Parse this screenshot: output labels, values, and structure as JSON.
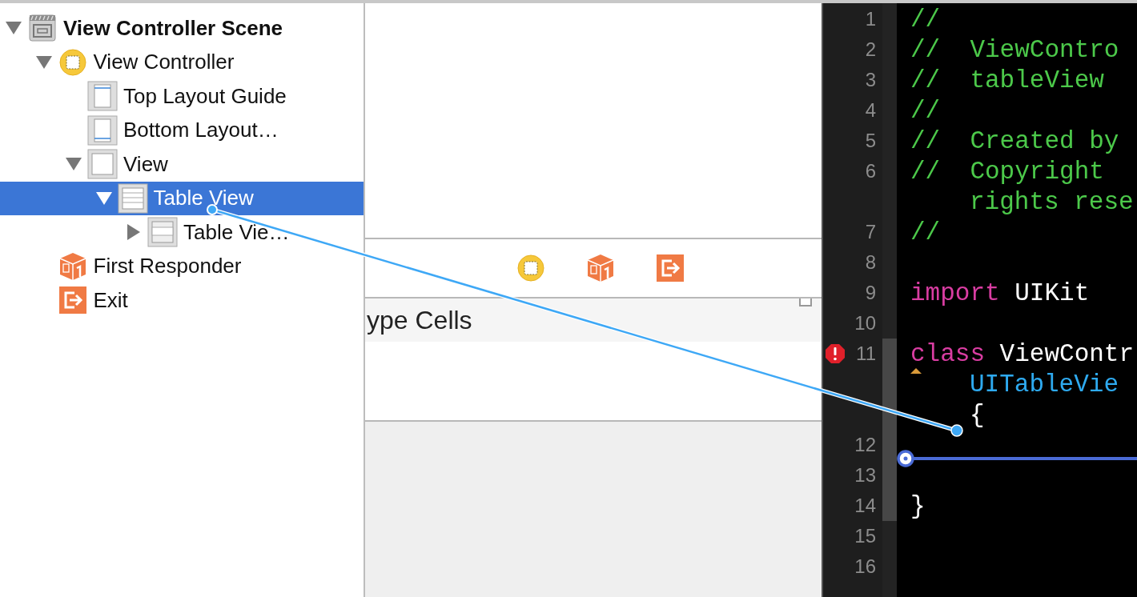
{
  "outline": {
    "items": [
      {
        "label": "View Controller Scene",
        "kind": "scene",
        "expanded": true,
        "selected": false,
        "children": [
          {
            "label": "View Controller",
            "kind": "controller",
            "expanded": true,
            "selected": false,
            "children": [
              {
                "label": "Top Layout Guide",
                "kind": "guide-top",
                "selected": false
              },
              {
                "label": "Bottom Layout…",
                "kind": "guide-bottom",
                "selected": false
              },
              {
                "label": "View",
                "kind": "view",
                "expanded": true,
                "selected": false,
                "children": [
                  {
                    "label": "Table View",
                    "kind": "table",
                    "expanded": true,
                    "selected": true,
                    "children": [
                      {
                        "label": "Table Vie…",
                        "kind": "table-cell",
                        "expanded": false,
                        "selected": false
                      }
                    ]
                  }
                ]
              }
            ]
          },
          {
            "label": "First Responder",
            "kind": "responder",
            "selected": false
          },
          {
            "label": "Exit",
            "kind": "exit",
            "selected": false
          }
        ]
      }
    ]
  },
  "canvas": {
    "dock_icons": [
      {
        "kind": "controller"
      },
      {
        "kind": "responder"
      },
      {
        "kind": "exit"
      }
    ],
    "section_header": "ype Cells"
  },
  "editor": {
    "rows": [
      {
        "number": "1",
        "segments": [
          {
            "kind": "comment",
            "text": "//"
          }
        ]
      },
      {
        "number": "2",
        "segments": [
          {
            "kind": "comment",
            "text": "//  ViewContro"
          }
        ]
      },
      {
        "number": "3",
        "segments": [
          {
            "kind": "comment",
            "text": "//  tableView"
          }
        ]
      },
      {
        "number": "4",
        "segments": [
          {
            "kind": "comment",
            "text": "//"
          }
        ]
      },
      {
        "number": "5",
        "segments": [
          {
            "kind": "comment",
            "text": "//  Created by"
          }
        ]
      },
      {
        "number": "6",
        "segments": [
          {
            "kind": "comment",
            "text": "//  Copyright"
          }
        ]
      },
      {
        "continuation": true,
        "segments": [
          {
            "kind": "comment",
            "text": "rights rese"
          }
        ]
      },
      {
        "number": "7",
        "segments": [
          {
            "kind": "comment",
            "text": "//"
          }
        ]
      },
      {
        "number": "8",
        "segments": []
      },
      {
        "number": "9",
        "segments": [
          {
            "kind": "keyword",
            "text": "import"
          },
          {
            "kind": "plain",
            "text": " UIKit"
          }
        ]
      },
      {
        "number": "10",
        "segments": []
      },
      {
        "number": "11",
        "changed": true,
        "error": true,
        "segments": [
          {
            "kind": "keyword",
            "text": "class"
          },
          {
            "kind": "plain",
            "text": " ViewContr"
          }
        ]
      },
      {
        "changed": true,
        "continuation": true,
        "segments": [
          {
            "kind": "type",
            "text": "UITableVie"
          }
        ]
      },
      {
        "changed": true,
        "continuation": true,
        "segments": [
          {
            "kind": "plain",
            "text": "{"
          }
        ]
      },
      {
        "number": "12",
        "changed": true,
        "segments": []
      },
      {
        "number": "13",
        "changed": true,
        "segments": []
      },
      {
        "number": "14",
        "changed": true,
        "segments": [
          {
            "kind": "plain",
            "text": "}"
          }
        ]
      },
      {
        "number": "15",
        "segments": []
      },
      {
        "number": "16",
        "segments": []
      }
    ]
  }
}
